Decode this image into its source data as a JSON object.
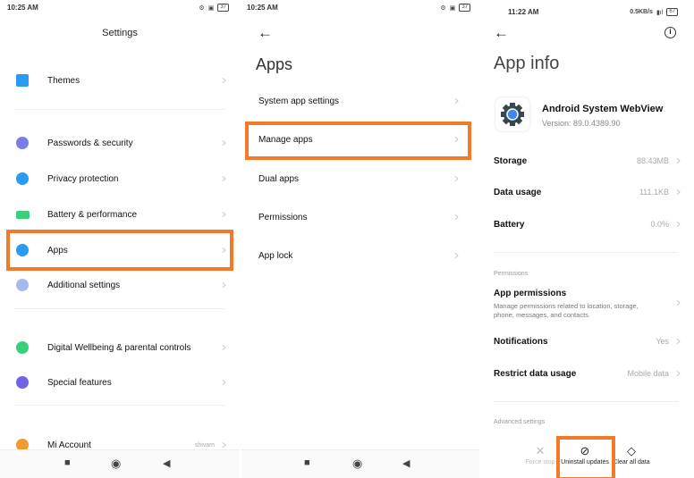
{
  "panel1": {
    "time": "10:25 AM",
    "battery": "37",
    "title": "Settings",
    "items": [
      {
        "label": "Themes",
        "icon": "themes-icon",
        "color": "#2a9bf0"
      },
      {
        "label": "Passwords & security",
        "icon": "fingerprint-icon",
        "color": "#7b7ce8"
      },
      {
        "label": "Privacy protection",
        "icon": "shield-icon",
        "color": "#2a9bf0"
      },
      {
        "label": "Battery & performance",
        "icon": "battery-icon",
        "color": "#3ad07a"
      },
      {
        "label": "Apps",
        "icon": "gear-icon",
        "color": "#2a9bf0"
      },
      {
        "label": "Additional settings",
        "icon": "more-icon",
        "color": "#a8b8ef"
      },
      {
        "label": "Digital Wellbeing & parental controls",
        "icon": "wellbeing-icon",
        "color": "#3ad07a"
      },
      {
        "label": "Special features",
        "icon": "flask-icon",
        "color": "#7263e8"
      },
      {
        "label": "Mi Account",
        "icon": "mi-icon",
        "color": "#f29a2e",
        "value": "shivam"
      }
    ]
  },
  "panel2": {
    "time": "10:25 AM",
    "battery": "37",
    "title": "Apps",
    "items": [
      "System app settings",
      "Manage apps",
      "Dual apps",
      "Permissions",
      "App lock"
    ]
  },
  "panel3": {
    "time": "11:22 AM",
    "net": "0.5KB/s",
    "battery": "67",
    "title": "App info",
    "app": {
      "name": "Android System WebView",
      "version": "Version: 89.0.4389.90"
    },
    "stats": [
      {
        "label": "Storage",
        "value": "88.43MB"
      },
      {
        "label": "Data usage",
        "value": "111.1KB"
      },
      {
        "label": "Battery",
        "value": "0.0%"
      }
    ],
    "permissions_header": "Permissions",
    "app_permissions": {
      "label": "App permissions",
      "desc1": "Manage permissions related to location, storage,",
      "desc2": "phone, messages, and contacts."
    },
    "notifications": {
      "label": "Notifications",
      "value": "Yes"
    },
    "restrict": {
      "label": "Restrict data usage",
      "value": "Mobile data"
    },
    "advanced_header": "Advanced settings",
    "actions": [
      {
        "label": "Force stop",
        "icon": "close-icon"
      },
      {
        "label": "Uninstall updates",
        "icon": "block-icon"
      },
      {
        "label": "Clear all data",
        "icon": "eraser-icon"
      }
    ]
  },
  "highlight_color": "#f47a2a"
}
